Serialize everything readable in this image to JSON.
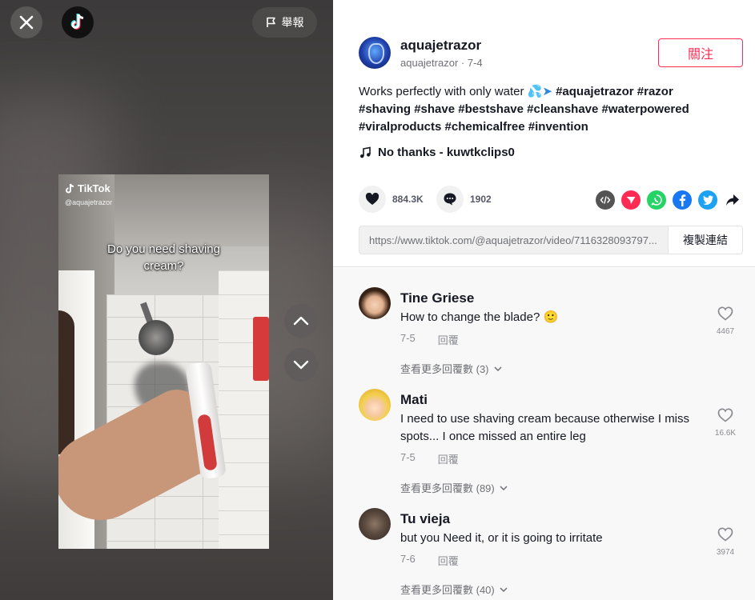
{
  "top_bar": {
    "report_label": "舉報"
  },
  "video": {
    "watermark": "TikTok",
    "watermark_user": "@aquajetrazor",
    "caption_line1": "Do you need shaving",
    "caption_line2": "cream?"
  },
  "author": {
    "name": "aquajetrazor",
    "handle": "aquajetrazor",
    "date": "7-4",
    "follow_label": "關注"
  },
  "description": {
    "text": "Works perfectly with only water",
    "emoji": "💦➤",
    "tags": [
      "#aquajetrazor",
      "#razor",
      "#shaving",
      "#shave",
      "#bestshave",
      "#cleanshave",
      "#waterpowered",
      "#viralproducts",
      "#chemicalfree",
      "#invention"
    ]
  },
  "music": "No thanks - kuwtkclips0",
  "stats": {
    "likes": "884.3K",
    "comments": "1902"
  },
  "share_icons": [
    "embed-icon",
    "send-icon",
    "whatsapp-icon",
    "facebook-icon",
    "twitter-icon",
    "share-arrow-icon"
  ],
  "link": {
    "url": "https://www.tiktok.com/@aquajetrazor/video/7116328093797...",
    "copy_label": "複製連結"
  },
  "comments": [
    {
      "name": "Tine Griese",
      "text": "How to change the blade? 🙂",
      "date": "7-5",
      "reply_label": "回覆",
      "more_label": "查看更多回覆數 (3)",
      "likes": "4467"
    },
    {
      "name": "Mati",
      "text": "I need to use shaving cream because otherwise I miss spots... I once missed an entire leg",
      "date": "7-5",
      "reply_label": "回覆",
      "more_label": "查看更多回覆數 (89)",
      "likes": "16.6K"
    },
    {
      "name": "Tu vieja",
      "text": "but you Need it, or it is going to irritate",
      "date": "7-6",
      "reply_label": "回覆",
      "more_label": "查看更多回覆數 (40)",
      "likes": "3974"
    }
  ],
  "colors": {
    "accent": "#fe2c55",
    "text": "#161823",
    "muted": "#8a8b91"
  }
}
